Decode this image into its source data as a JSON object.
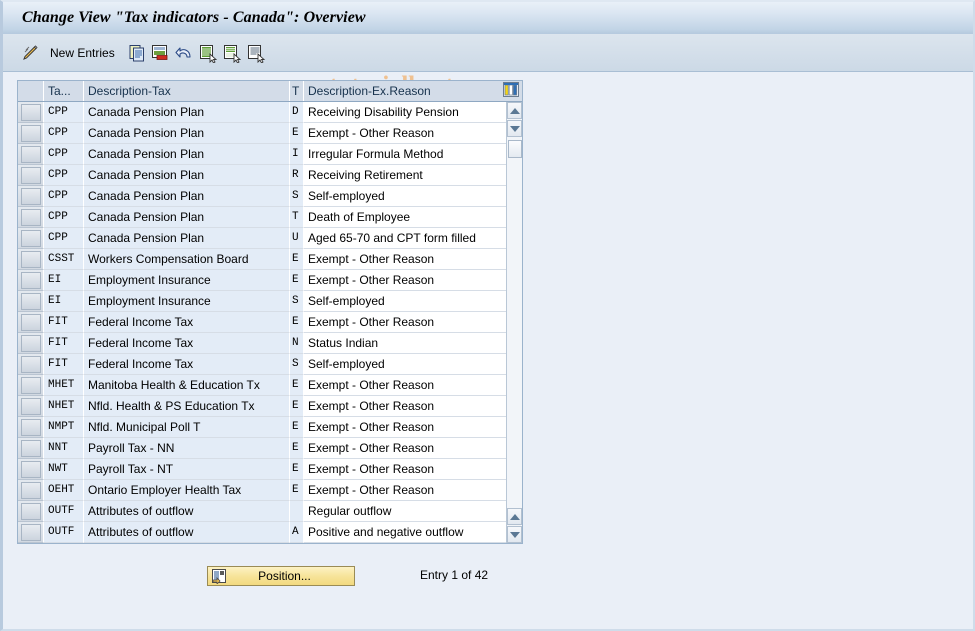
{
  "window": {
    "title": "Change View \"Tax indicators - Canada\": Overview"
  },
  "watermark": "www.tutorialkart.com",
  "toolbar": {
    "edit_icon": "pencil-icon",
    "new_entries_label": "New Entries",
    "buttons": [
      {
        "name": "copy-as-button",
        "icon": "copy-icon"
      },
      {
        "name": "delete-button",
        "icon": "delete-row-icon"
      },
      {
        "name": "undo-button",
        "icon": "undo-icon"
      },
      {
        "name": "select-all-button",
        "icon": "select-all-icon"
      },
      {
        "name": "select-block-button",
        "icon": "select-block-icon"
      },
      {
        "name": "deselect-all-button",
        "icon": "deselect-all-icon"
      }
    ]
  },
  "table": {
    "config_icon": "table-settings-icon",
    "columns": [
      {
        "key": "sel",
        "label": ""
      },
      {
        "key": "tax",
        "label": "Ta..."
      },
      {
        "key": "desc",
        "label": "Description-Tax"
      },
      {
        "key": "t",
        "label": "T"
      },
      {
        "key": "exr",
        "label": "Description-Ex.Reason"
      }
    ],
    "rows": [
      {
        "tax": "CPP",
        "desc": "Canada Pension Plan",
        "t": "D",
        "exr": "Receiving Disability Pension"
      },
      {
        "tax": "CPP",
        "desc": "Canada Pension Plan",
        "t": "E",
        "exr": "Exempt - Other Reason"
      },
      {
        "tax": "CPP",
        "desc": "Canada Pension Plan",
        "t": "I",
        "exr": "Irregular Formula Method"
      },
      {
        "tax": "CPP",
        "desc": "Canada Pension Plan",
        "t": "R",
        "exr": "Receiving Retirement"
      },
      {
        "tax": "CPP",
        "desc": "Canada Pension Plan",
        "t": "S",
        "exr": "Self-employed"
      },
      {
        "tax": "CPP",
        "desc": "Canada Pension Plan",
        "t": "T",
        "exr": "Death of Employee"
      },
      {
        "tax": "CPP",
        "desc": "Canada Pension Plan",
        "t": "U",
        "exr": "Aged 65-70 and CPT form filled"
      },
      {
        "tax": "CSST",
        "desc": "Workers Compensation Board",
        "t": "E",
        "exr": "Exempt - Other Reason"
      },
      {
        "tax": "EI",
        "desc": "Employment Insurance",
        "t": "E",
        "exr": "Exempt - Other Reason"
      },
      {
        "tax": "EI",
        "desc": "Employment Insurance",
        "t": "S",
        "exr": "Self-employed"
      },
      {
        "tax": "FIT",
        "desc": "Federal Income Tax",
        "t": "E",
        "exr": "Exempt - Other Reason"
      },
      {
        "tax": "FIT",
        "desc": "Federal Income Tax",
        "t": "N",
        "exr": "Status Indian"
      },
      {
        "tax": "FIT",
        "desc": "Federal Income Tax",
        "t": "S",
        "exr": "Self-employed"
      },
      {
        "tax": "MHET",
        "desc": "Manitoba Health & Education Tx",
        "t": "E",
        "exr": "Exempt - Other Reason"
      },
      {
        "tax": "NHET",
        "desc": "Nfld. Health & PS Education Tx",
        "t": "E",
        "exr": "Exempt - Other Reason"
      },
      {
        "tax": "NMPT",
        "desc": "Nfld. Municipal Poll T",
        "t": "E",
        "exr": "Exempt - Other Reason"
      },
      {
        "tax": "NNT",
        "desc": "Payroll Tax - NN",
        "t": "E",
        "exr": "Exempt - Other Reason"
      },
      {
        "tax": "NWT",
        "desc": "Payroll Tax - NT",
        "t": "E",
        "exr": "Exempt - Other Reason"
      },
      {
        "tax": "OEHT",
        "desc": "Ontario Employer Health Tax",
        "t": "E",
        "exr": "Exempt - Other Reason"
      },
      {
        "tax": "OUTF",
        "desc": "Attributes of outflow",
        "t": "",
        "exr": "Regular outflow"
      },
      {
        "tax": "OUTF",
        "desc": "Attributes of outflow",
        "t": "A",
        "exr": "Positive and negative outflow"
      }
    ]
  },
  "footer": {
    "position_button_label": "Position...",
    "entry_status": "Entry 1 of 42"
  },
  "colors": {
    "title_bar": "#c2d4e6",
    "toolbar": "#d4dfea",
    "page_background": "#eaeff7",
    "key_column": "#e3ecf7",
    "header": "#d3dce8",
    "watermark": "#f0b980",
    "button_yellow": "#f7e49b"
  }
}
